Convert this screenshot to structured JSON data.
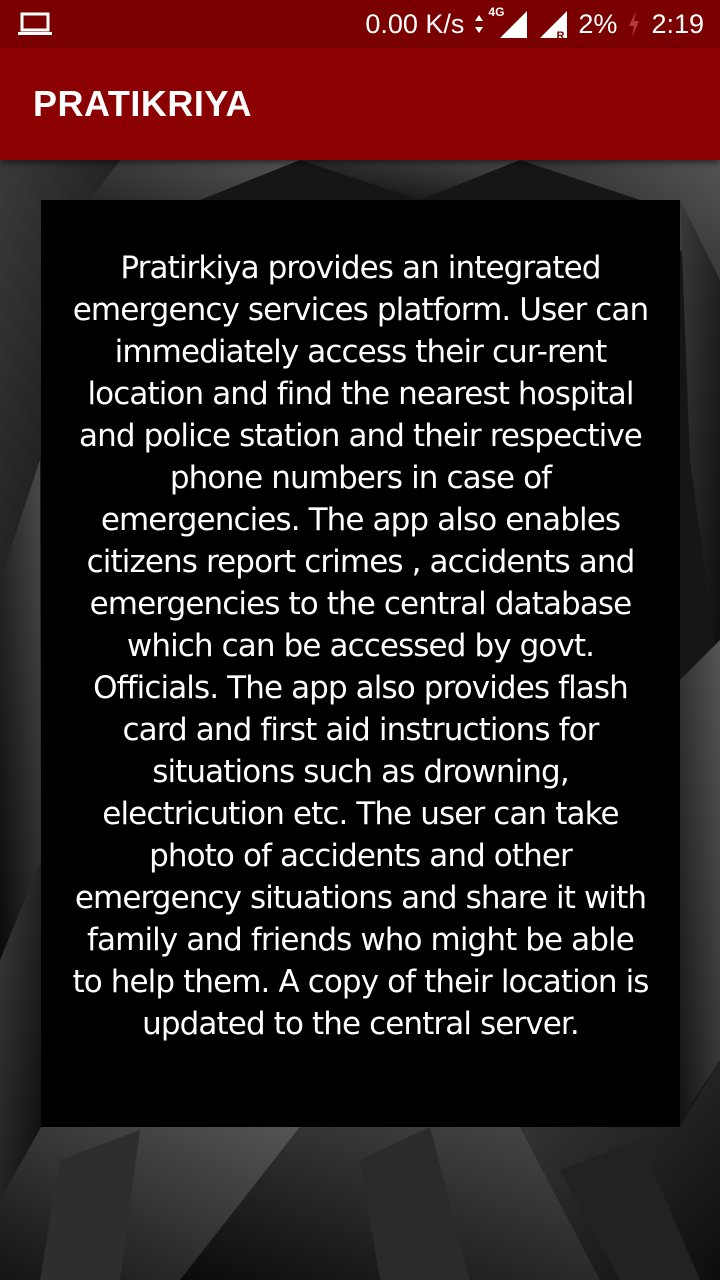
{
  "status_bar": {
    "icons": {
      "left": "laptop-icon",
      "data_arrows": "data-transfer-arrows-icon",
      "signal": "cell-signal-icon",
      "signal_roaming": "cell-signal-roaming-icon",
      "battery": "charging-bolt-icon"
    },
    "network_speed": "0.00 K/s",
    "network_type": "4G",
    "roaming_indicator": "R",
    "battery_level": "2%",
    "time": "2:19"
  },
  "app_bar": {
    "title": "PRATIKRIYA",
    "color": "#8b0000"
  },
  "about": {
    "description": "Pratirkiya provides an integrated emergency services platform. User can immediately access their cur-rent location and find the nearest hospital and police station and their respective phone numbers in case of emergencies. The app also enables citizens report crimes , accidents and emergencies to the central database which can be accessed by govt. Officials. The app also provides flash card and first aid instructions for situations such as drowning, electricution etc. The user can take photo of accidents and other emergency situations and share it with family and friends who might be able to help them. A copy of their location is updated to the central server."
  },
  "colors": {
    "status_bar": "#7a0000",
    "app_bar": "#8b0000",
    "card": "#000000",
    "text": "#ffffff"
  }
}
